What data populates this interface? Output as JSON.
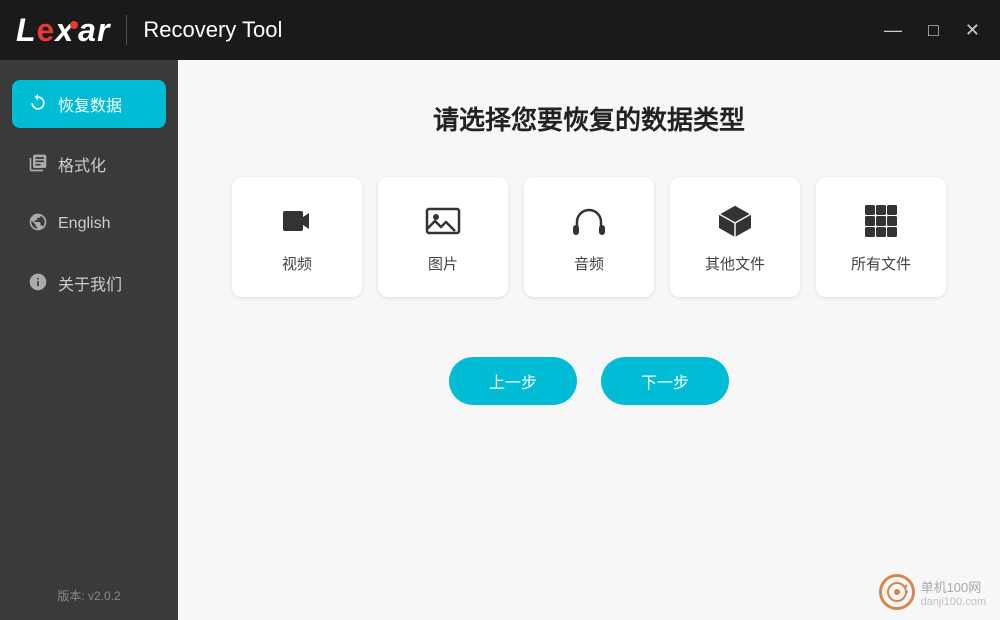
{
  "titlebar": {
    "logo": "Lexar",
    "divider": true,
    "app_title": "Recovery Tool",
    "controls": {
      "minimize": "—",
      "maximize": "□",
      "close": "✕"
    }
  },
  "sidebar": {
    "items": [
      {
        "id": "recover",
        "label": "恢复数据",
        "icon": "recover",
        "active": true
      },
      {
        "id": "format",
        "label": "格式化",
        "icon": "format",
        "active": false
      },
      {
        "id": "language",
        "label": "English",
        "icon": "globe",
        "active": false
      },
      {
        "id": "about",
        "label": "关于我们",
        "icon": "info",
        "active": false
      }
    ],
    "version": "版本: v2.0.2"
  },
  "content": {
    "title": "请选择您要恢复的数据类型",
    "file_types": [
      {
        "id": "video",
        "label": "视频",
        "icon": "video"
      },
      {
        "id": "image",
        "label": "图片",
        "icon": "image"
      },
      {
        "id": "audio",
        "label": "音频",
        "icon": "audio"
      },
      {
        "id": "other",
        "label": "其他文件",
        "icon": "cube"
      },
      {
        "id": "all",
        "label": "所有文件",
        "icon": "grid"
      }
    ],
    "buttons": {
      "prev": "上一步",
      "next": "下一步"
    }
  },
  "watermark": {
    "text": "单机100网",
    "sub": "danji100.com"
  },
  "colors": {
    "accent": "#00bcd4",
    "sidebar_bg": "#3a3a3a",
    "titlebar_bg": "#1a1a1a",
    "active_item": "#00bcd4"
  }
}
